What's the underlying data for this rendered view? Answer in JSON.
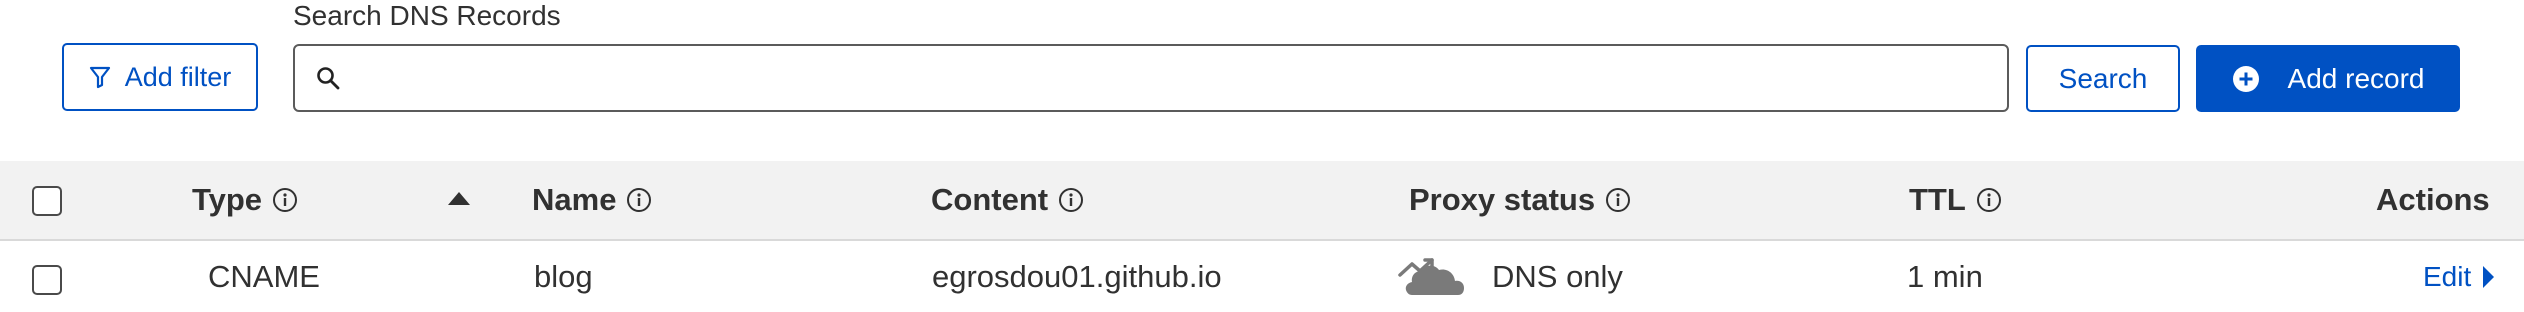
{
  "toolbar": {
    "add_filter_label": "Add filter",
    "search_label": "Search DNS Records",
    "search_value": "",
    "search_button_label": "Search",
    "add_record_label": "Add record"
  },
  "table": {
    "columns": {
      "type": "Type",
      "name": "Name",
      "content": "Content",
      "proxy_status": "Proxy status",
      "ttl": "TTL",
      "actions": "Actions"
    },
    "rows": [
      {
        "type": "CNAME",
        "name": "blog",
        "content": "egrosdou01.github.io",
        "proxy_status": "DNS only",
        "ttl": "1 min",
        "action_label": "Edit"
      }
    ]
  },
  "colors": {
    "accent": "#0051c3",
    "header_bg": "#f2f2f2",
    "text": "#313131"
  }
}
